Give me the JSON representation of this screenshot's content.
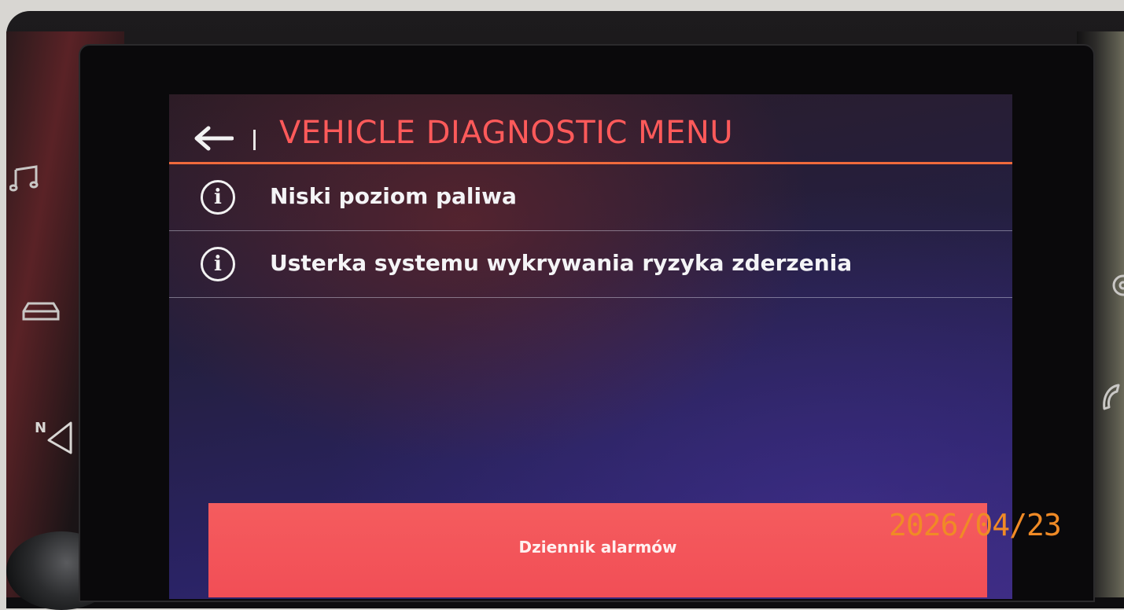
{
  "screen": {
    "header": {
      "title": "VEHICLE DIAGNOSTIC MENU",
      "back_icon": "arrow-left-icon"
    },
    "alerts": [
      {
        "icon": "info-icon",
        "text": "Niski poziom paliwa"
      },
      {
        "icon": "info-icon",
        "text": "Usterka systemu wykrywania ryzyka zderzenia"
      }
    ],
    "footer": {
      "button_label": "Dziennik alarmów"
    }
  },
  "side_buttons": {
    "left": [
      "music-note-icon",
      "car-icon",
      "navigation-icon"
    ],
    "right": [
      "settings-icon",
      "phone-icon"
    ]
  },
  "photo_overlay": {
    "date_stamp": "2026/04/23"
  },
  "colors": {
    "accent_title": "#ff5a5a",
    "header_rule": "#f06a3c",
    "alarm_bar": "#f24e56",
    "screen_bg": "#2a2365",
    "date_stamp": "#f08a26"
  }
}
